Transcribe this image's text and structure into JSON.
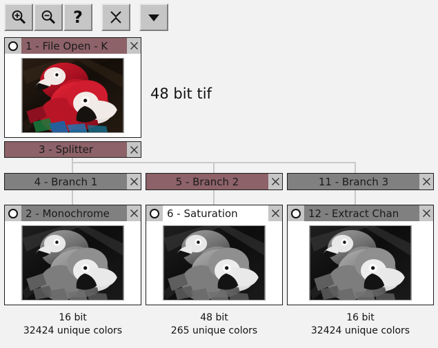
{
  "toolbar": {
    "buttons": [
      {
        "name": "zoom-in-icon",
        "label": "Zoom In"
      },
      {
        "name": "zoom-out-icon",
        "label": "Zoom Out"
      },
      {
        "name": "help-icon",
        "label": "?"
      },
      {
        "name": "collapse-icon",
        "label": "Collapse"
      },
      {
        "name": "dropdown-arrow-icon",
        "label": "More"
      }
    ]
  },
  "annotations": {
    "source_format": "48 bit tif"
  },
  "nodes": {
    "file_open": {
      "title": "1 - File Open - K",
      "close_label": "×",
      "state": "active"
    },
    "splitter": {
      "title": "3 - Splitter",
      "close_label": "×",
      "state": "active"
    },
    "branch1": {
      "title": "4 - Branch 1",
      "close_label": "×",
      "state": "inactive"
    },
    "branch2": {
      "title": "5 - Branch 2",
      "close_label": "×",
      "state": "active"
    },
    "branch3": {
      "title": "11 - Branch 3",
      "close_label": "×",
      "state": "inactive"
    },
    "monochrome": {
      "title": "2 - Monochrome",
      "close_label": "×",
      "state": "inactive",
      "caption_line1": "16 bit",
      "caption_line2": "32424 unique colors"
    },
    "saturation": {
      "title": "6 - Saturation",
      "close_label": "×",
      "state": "selected",
      "caption_line1": "48 bit",
      "caption_line2": "265 unique colors"
    },
    "extract_channel": {
      "title": "12 - Extract Chan",
      "close_label": "×",
      "state": "inactive",
      "caption_line1": "16 bit",
      "caption_line2": "32424 unique colors"
    }
  },
  "colors": {
    "active_title_bg": "#8d6268",
    "inactive_title_bg": "#808080",
    "selected_title_bg": "#ffffff",
    "canvas_bg": "#f2f2f2",
    "button_face": "#c6c6c6",
    "connector": "#c8c8c8"
  }
}
